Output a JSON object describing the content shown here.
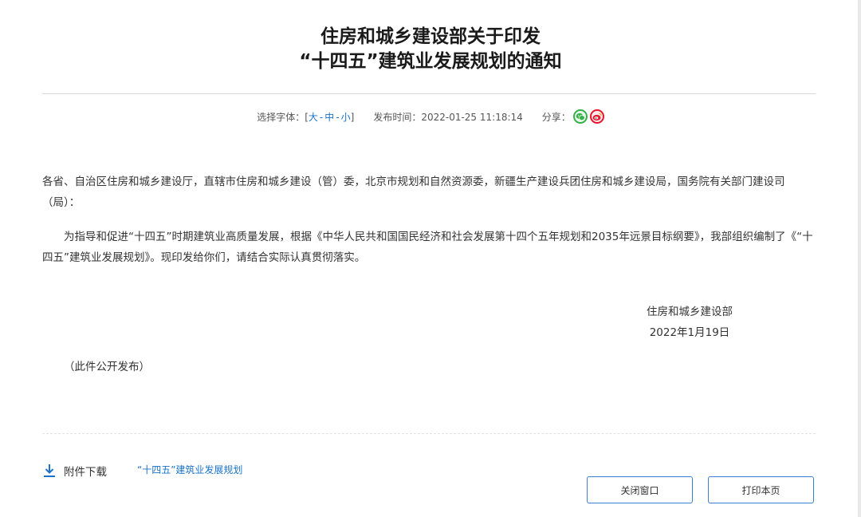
{
  "title": {
    "line1": "住房和城乡建设部关于印发",
    "line2": "“十四五”建筑业发展规划的通知"
  },
  "meta": {
    "font_prefix": "选择字体：[",
    "font_large": "大",
    "font_medium": "中",
    "font_small": "小",
    "font_sep": "-",
    "font_suffix": "]",
    "publish_label": "发布时间：",
    "publish_time": "2022-01-25 11:18:14",
    "share_label": "分享：",
    "share_icons": [
      "wechat-icon",
      "weibo-icon"
    ]
  },
  "body": {
    "paragraph1": "各省、自治区住房和城乡建设厅，直辖市住房和城乡建设（管）委，北京市规划和自然资源委，新疆生产建设兵团住房和城乡建设局，国务院有关部门建设司（局）：",
    "paragraph2": "为指导和促进“十四五”时期建筑业高质量发展，根据《中华人民共和国国民经济和社会发展第十四个五年规划和2035年远景目标纲要》，我部组织编制了《“十四五”建筑业发展规划》。现印发给你们，请结合实际认真贯彻落实。"
  },
  "signature": {
    "org": "住房和城乡建设部",
    "date": "2022年1月19日"
  },
  "note": "（此件公开发布）",
  "attachment": {
    "label": "附件下载",
    "link": "“十四五”建筑业发展规划"
  },
  "buttons": {
    "close": "关闭窗口",
    "print": "打印本页"
  },
  "colors": {
    "link": "#1a73c8",
    "wechat": "#36b24a",
    "weibo": "#e6162d",
    "button_border": "#3b7fd0"
  }
}
